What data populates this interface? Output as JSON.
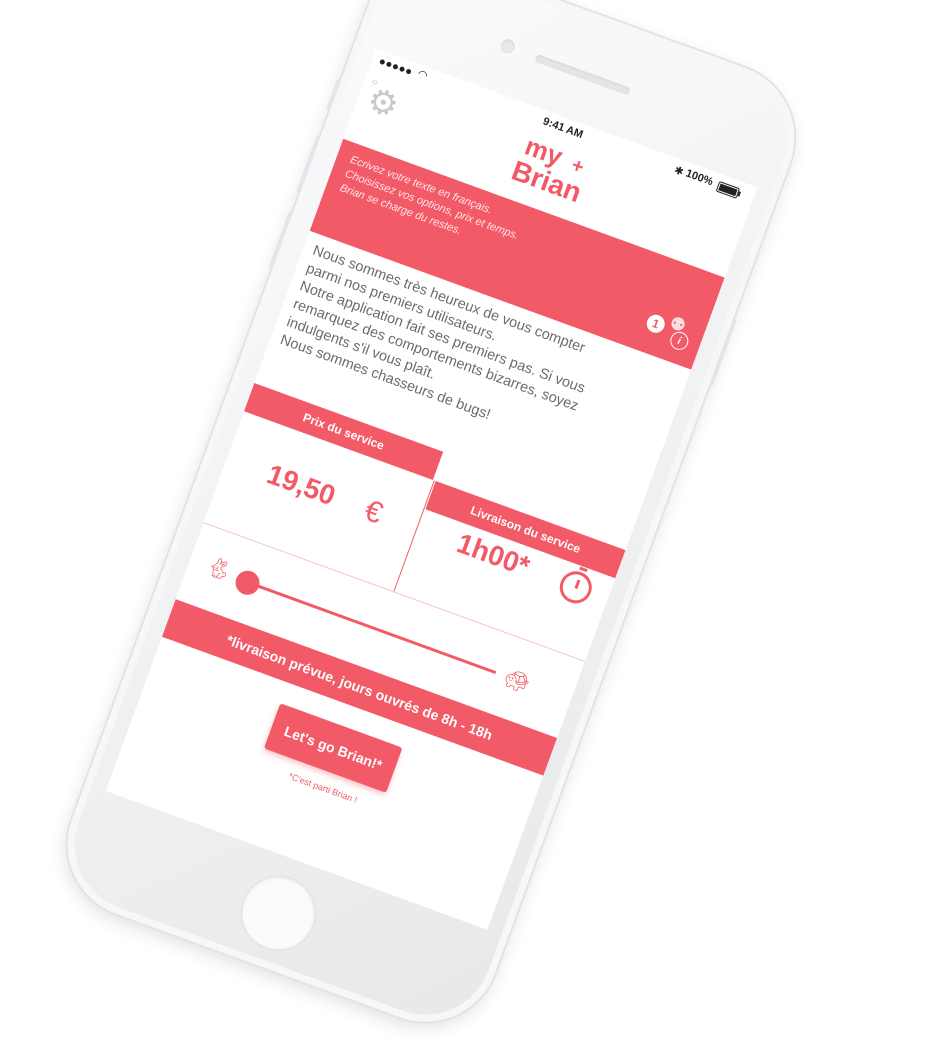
{
  "status_bar": {
    "time": "9:41 AM",
    "battery": "100%",
    "bluetooth_icon": "bluetooth-icon",
    "wifi_icon": "wifi-icon"
  },
  "header": {
    "logo_line1": "my",
    "logo_plus": "+",
    "logo_line2": "Brian",
    "settings_icon": "gear-icon"
  },
  "banner": {
    "line1": "Ecrivez votre texte en français.",
    "line2": "Choisissez vos options, prix et temps.",
    "line3": "Brian se charge du restes.",
    "badge_count": "1",
    "info_label": "i"
  },
  "welcome": {
    "line1": "Nous sommes très heureux de vous compter",
    "line2": "parmi nos premiers utilisateurs.",
    "line3": "Notre application fait ses premiers pas. Si vous",
    "line4": "remarquez des comportements bizarres, soyez",
    "line5": "indulgents s'il vous plaît.",
    "line6": "Nous sommes chasseurs de bugs!"
  },
  "service": {
    "price_header": "Prix du service",
    "price_value": "19,50",
    "currency": "€",
    "delivery_header": "Livraison du service",
    "delivery_value": "1h00*",
    "timer_icon": "stopwatch-icon"
  },
  "slider": {
    "min_icon": "rabbit-icon",
    "max_icon": "turtle-icon",
    "value_fraction": 0.0
  },
  "note": "*livraison prévue, jours ouvrés de 8h - 18h",
  "cta": {
    "label": "Let's go Brian!*",
    "sub": "*C'est parti Brian !"
  },
  "colors": {
    "accent": "#f35a67",
    "text_gray": "#6b6b6b"
  }
}
